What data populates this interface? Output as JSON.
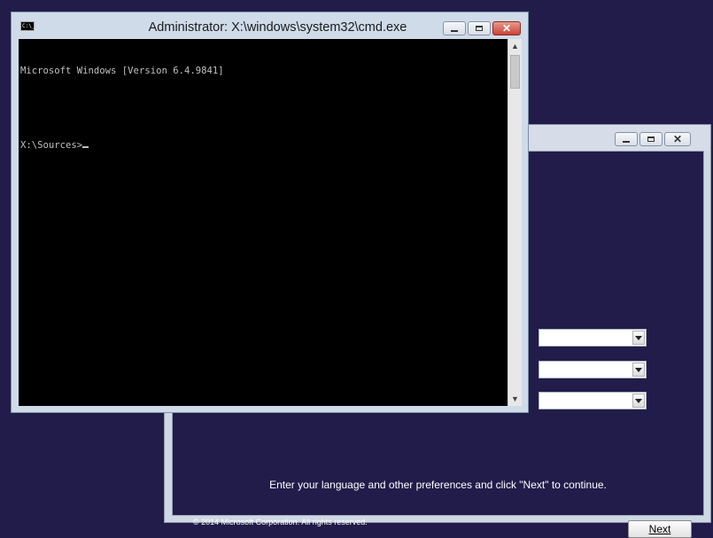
{
  "desktop": {
    "background": "#211c4a"
  },
  "cmd": {
    "title": "Administrator: X:\\windows\\system32\\cmd.exe",
    "icon_text": "C:\\_",
    "lines": [
      "Microsoft Windows [Version 6.4.9841]",
      "",
      "X:\\Sources>"
    ],
    "colors": {
      "console_bg": "#000000",
      "console_fg": "#c0c0c0",
      "close_button": "#c9433a"
    },
    "scroll_up_icon": "▲",
    "scroll_down_icon": "▼"
  },
  "setup": {
    "instructions": "Enter your language and other preferences and click \"Next\" to continue.",
    "copyright": "© 2014 Microsoft Corporation. All rights reserved.",
    "next_label": "Next",
    "dropdowns": [
      {
        "value": ""
      },
      {
        "value": ""
      },
      {
        "value": ""
      }
    ]
  }
}
